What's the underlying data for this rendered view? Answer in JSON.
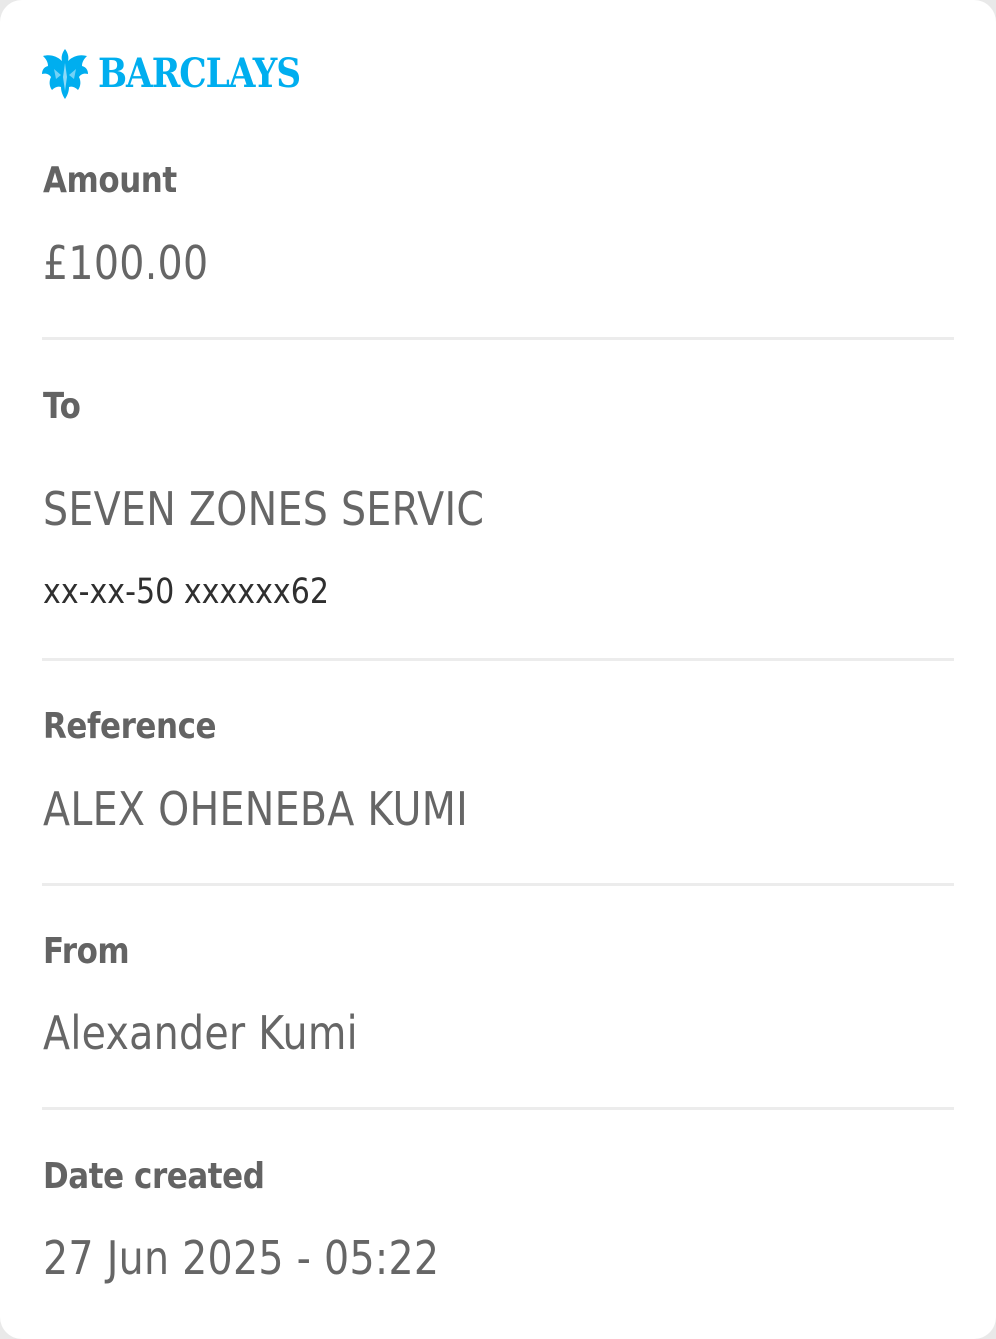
{
  "brand": {
    "name": "BARCLAYS",
    "logo_icon": "eagle-icon",
    "color": "#00AEEF"
  },
  "amount": {
    "label": "Amount",
    "value": "£100.00"
  },
  "to": {
    "label": "To",
    "name": "SEVEN ZONES SERVIC",
    "account": "xx-xx-50 xxxxxx62"
  },
  "reference": {
    "label": "Reference",
    "value": "ALEX OHENEBA KUMI"
  },
  "from": {
    "label": "From",
    "value": "Alexander Kumi"
  },
  "date_created": {
    "label": "Date created",
    "value": "27 Jun 2025 - 05:22"
  }
}
